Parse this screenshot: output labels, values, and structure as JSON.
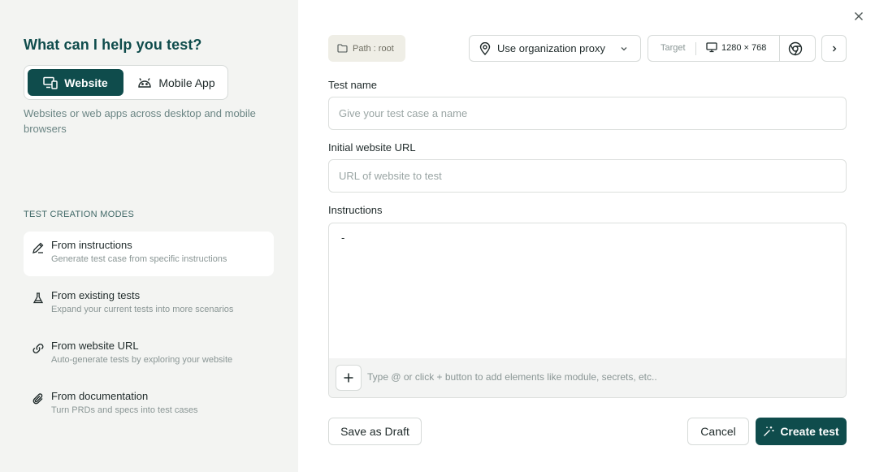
{
  "left": {
    "heading": "What can I help you test?",
    "segments": [
      {
        "label": "Website",
        "icon": "devices-icon",
        "active": true
      },
      {
        "label": "Mobile App",
        "icon": "android-icon",
        "active": false
      }
    ],
    "segment_description": "Websites or web apps across desktop and mobile browsers",
    "modes_title": "TEST CREATION MODES",
    "modes": [
      {
        "title": "From instructions",
        "subtitle": "Generate test case from specific instructions",
        "icon": "pencil-icon",
        "active": true
      },
      {
        "title": "From existing tests",
        "subtitle": "Expand your current tests into more scenarios",
        "icon": "flask-icon",
        "active": false
      },
      {
        "title": "From website URL",
        "subtitle": "Auto-generate tests by exploring your website",
        "icon": "link-icon",
        "active": false
      },
      {
        "title": "From documentation",
        "subtitle": "Turn PRDs and specs into test cases",
        "icon": "paperclip-icon",
        "active": false
      }
    ]
  },
  "toolbar": {
    "path_label": "Path : root",
    "proxy_label": "Use organization proxy",
    "target_label": "Target",
    "resolution": "1280 × 768",
    "browser_icon": "chrome-icon"
  },
  "form": {
    "test_name_label": "Test name",
    "test_name_placeholder": "Give your test case a name",
    "url_label": "Initial website URL",
    "url_placeholder": "URL of website to test",
    "instructions_label": "Instructions",
    "instructions_value": "-",
    "instructions_hint": "Type @ or click + button to add elements like module, secrets, etc.."
  },
  "actions": {
    "save_draft": "Save as Draft",
    "cancel": "Cancel",
    "create": "Create test"
  },
  "colors": {
    "accent": "#0f4c4c",
    "left_panel_bg": "#f3f4f2"
  }
}
